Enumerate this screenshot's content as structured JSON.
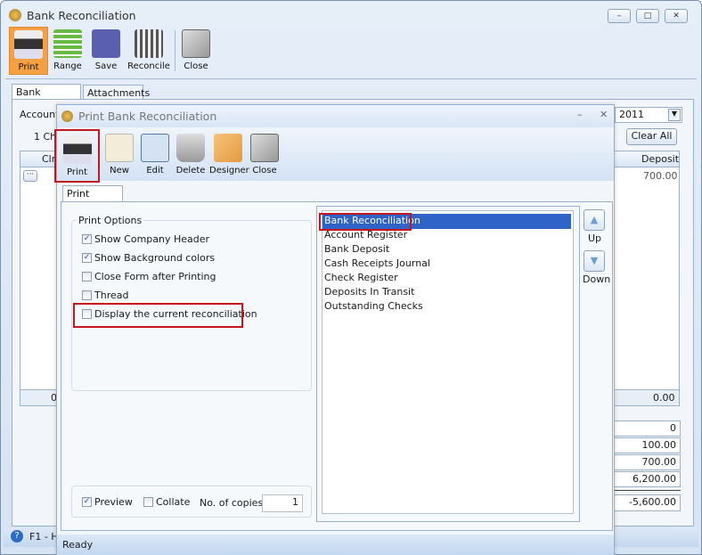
{
  "main": {
    "title": "Bank Reconciliation",
    "toolbar": [
      "Print",
      "Range",
      "Save",
      "Reconcile",
      "Close"
    ],
    "tabs": [
      "Bank Accounts",
      "Attachments"
    ],
    "account_label": "Account",
    "account_value": "2011",
    "count_label": "1 Ch",
    "clear_all": "Clear All",
    "grid": {
      "col_clr": "Clr",
      "col_deposit": "Deposit",
      "row_deposit": "700.00",
      "footer_left": "0",
      "footer_right": "0.00"
    },
    "summary": [
      "0",
      "100.00",
      "700.00",
      "6,200.00",
      "-5,600.00"
    ],
    "status": "F1 - H"
  },
  "dialog": {
    "title": "Print Bank Reconciliation",
    "toolbar": [
      "Print",
      "New",
      "Edit",
      "Delete",
      "Designer",
      "Close"
    ],
    "tab": "Print Criteria",
    "options_title": "Print Options",
    "options": [
      {
        "label": "Show Company Header",
        "checked": true
      },
      {
        "label": "Show Background colors",
        "checked": true
      },
      {
        "label": "Close Form after Printing",
        "checked": false
      },
      {
        "label": "Thread",
        "checked": false
      },
      {
        "label": "Display the current reconciliation",
        "checked": false
      }
    ],
    "preview": {
      "label": "Preview",
      "checked": true
    },
    "collate": {
      "label": "Collate",
      "checked": false
    },
    "copies_label": "No. of copies",
    "copies": "1",
    "reports": [
      "Bank Reconciliation",
      "Account Register",
      "Bank Deposit",
      "Cash Receipts Journal",
      "Check Register",
      "Deposits In Transit",
      "Outstanding Checks"
    ],
    "selected_report": "Bank Reconciliation",
    "up": "Up",
    "down": "Down",
    "status": "Ready"
  },
  "colors": {
    "selection": "#2f63c7",
    "highlight": "#c4161c",
    "active_tool": "#f6a043"
  }
}
